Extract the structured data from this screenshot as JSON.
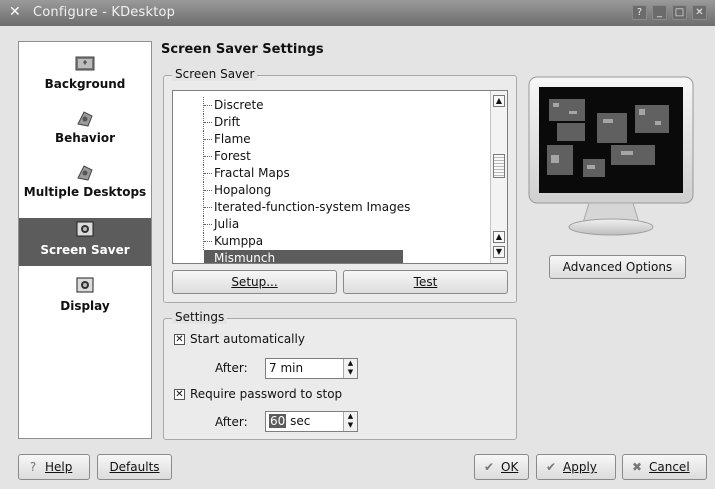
{
  "window": {
    "title": "Configure - KDesktop",
    "controls": [
      "?",
      "_",
      "□",
      "✕"
    ]
  },
  "sidebar": {
    "items": [
      {
        "label": "Background",
        "icon": "background-icon"
      },
      {
        "label": "Behavior",
        "icon": "behavior-icon"
      },
      {
        "label": "Multiple Desktops",
        "icon": "multiple-desktops-icon"
      },
      {
        "label": "Screen Saver",
        "icon": "screen-saver-icon",
        "active": true
      },
      {
        "label": "Display",
        "icon": "display-icon"
      }
    ]
  },
  "main": {
    "title": "Screen Saver Settings",
    "screensaver_group": {
      "title": "Screen Saver",
      "list": [
        "Discrete",
        "Drift",
        "Flame",
        "Forest",
        "Fractal Maps",
        "Hopalong",
        "Iterated-function-system Images",
        "Julia",
        "Kumppa",
        "Mismunch"
      ],
      "selected": "Mismunch",
      "setup_label": "Setup...",
      "test_label": "Test"
    },
    "advanced_label": "Advanced Options",
    "settings_group": {
      "title": "Settings",
      "start_auto_label": "Start automatically",
      "start_auto_checked": true,
      "after1_label": "After:",
      "after1_value": "7 min",
      "require_pw_label": "Require password to stop",
      "require_pw_checked": true,
      "after2_label": "After:",
      "after2_value_num": "60",
      "after2_value_unit": " sec"
    }
  },
  "footer": {
    "help_label": "Help",
    "defaults_label": "Defaults",
    "ok_label": "OK",
    "apply_label": "Apply",
    "cancel_label": "Cancel"
  }
}
